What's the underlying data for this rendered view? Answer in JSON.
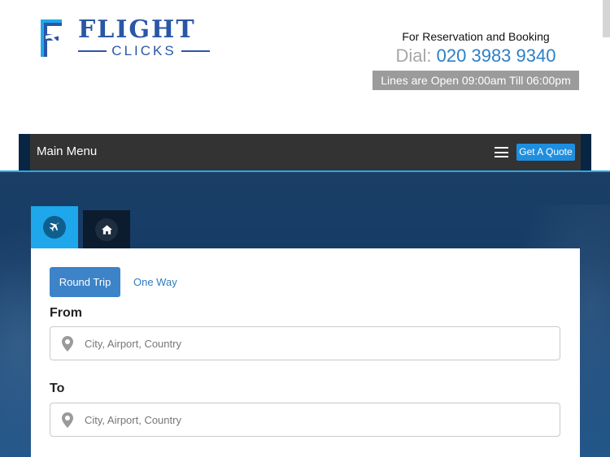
{
  "header": {
    "logo": {
      "word1": "FLIGHT",
      "word2": "CLICKS"
    },
    "contact": {
      "reservation_text": "For Reservation and Booking",
      "dial_label": "Dial:",
      "phone": "020 3983 9340",
      "hours": "Lines are Open 09:00am Till 06:00pm"
    }
  },
  "nav": {
    "menu_label": "Main Menu",
    "menu_icon": "hamburger-icon",
    "quote_button": "Get A Quote"
  },
  "search": {
    "tabs": [
      {
        "icon": "airplane-icon",
        "active": true
      },
      {
        "icon": "home-icon",
        "active": false
      }
    ],
    "trip_types": {
      "round_trip": "Round Trip",
      "one_way": "One Way",
      "selected": "Round Trip"
    },
    "from": {
      "label": "From",
      "placeholder": "City, Airport, Country",
      "value": "",
      "icon": "location-pin-icon"
    },
    "to": {
      "label": "To",
      "placeholder": "City, Airport, Country",
      "value": "",
      "icon": "location-pin-icon"
    }
  },
  "colors": {
    "brand_blue": "#2a56a6",
    "phone_blue": "#2c7fc9",
    "nav_bg": "#333333",
    "quote_button": "#1e8fe0",
    "active_tab": "#1ea7ea",
    "round_trip_button": "#3c83c8"
  }
}
